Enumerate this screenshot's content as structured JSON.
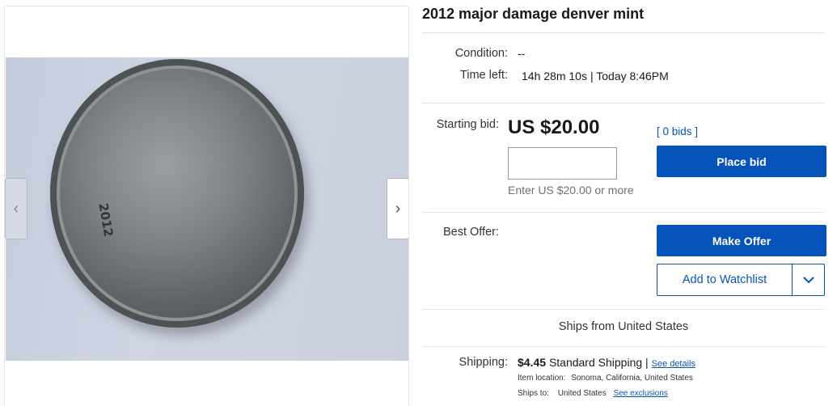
{
  "listing": {
    "title": "2012 major damage denver mint"
  },
  "image_panel": {
    "coin_year_text": "2012",
    "prev_arrow": "‹",
    "next_arrow": "›"
  },
  "details": {
    "condition_label": "Condition:",
    "condition_value": "--",
    "time_left_label": "Time left:",
    "time_left_value": "14h 28m 10s",
    "end_time": "| Today 8:46PM"
  },
  "bidding": {
    "starting_bid_label": "Starting bid:",
    "price": "US $20.00",
    "bids_text": "[ 0 bids ]",
    "bid_input_value": "",
    "bid_hint": "Enter US $20.00 or more",
    "place_bid_label": "Place bid"
  },
  "offer": {
    "best_offer_label": "Best Offer:",
    "make_offer_label": "Make Offer",
    "watchlist_label": "Add to Watchlist"
  },
  "shipping": {
    "ships_from": "Ships from United States",
    "shipping_label": "Shipping:",
    "shipping_price": "$4.45",
    "shipping_method": "Standard Shipping |",
    "see_details": "See details",
    "item_location_label": "Item location:",
    "item_location_value": "Sonoma, California, United States",
    "ships_to_label": "Ships to:",
    "ships_to_value": "United States",
    "see_exclusions": "See exclusions"
  },
  "colors": {
    "accent": "#0654ba",
    "text": "#191919",
    "muted": "#707070",
    "divider": "#e5e5e5"
  }
}
